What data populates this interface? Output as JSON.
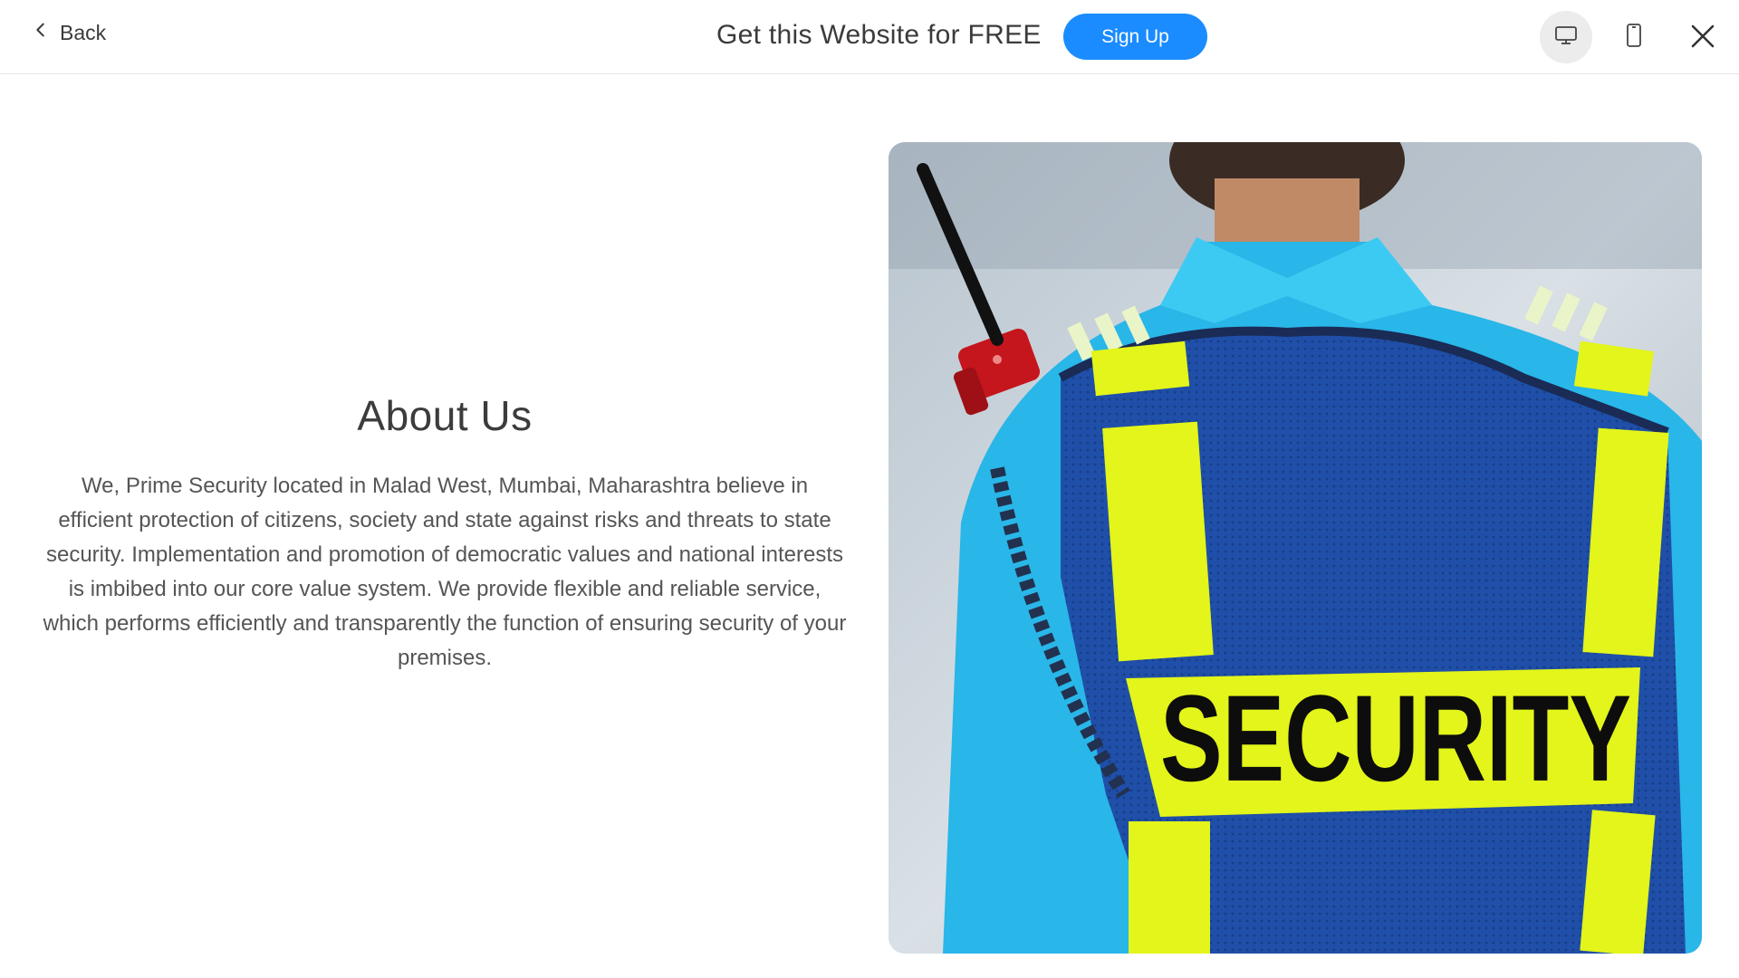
{
  "topbar": {
    "back_label": "Back",
    "promo_text": "Get this Website for FREE",
    "signup_label": "Sign Up"
  },
  "about": {
    "title": "About Us",
    "body": "We, Prime Security located in Malad West, Mumbai, Maharashtra believe in efficient protection of citizens, society and state against risks and threats to state security. Implementation and promotion of democratic values and national interests is imbibed into our core value system. We provide flexible and reliable service, which performs efficiently and transparently the function of ensuring security of your premises."
  },
  "photo": {
    "vest_text": "SECURITY"
  },
  "icons": {
    "back": "chevron-left-icon",
    "desktop": "desktop-icon",
    "mobile": "mobile-icon",
    "close": "close-icon"
  },
  "colors": {
    "accent": "#1a8cff",
    "vest_blue": "#1f4fa8",
    "reflective": "#e3f51a",
    "shirt": "#29b6e8"
  }
}
